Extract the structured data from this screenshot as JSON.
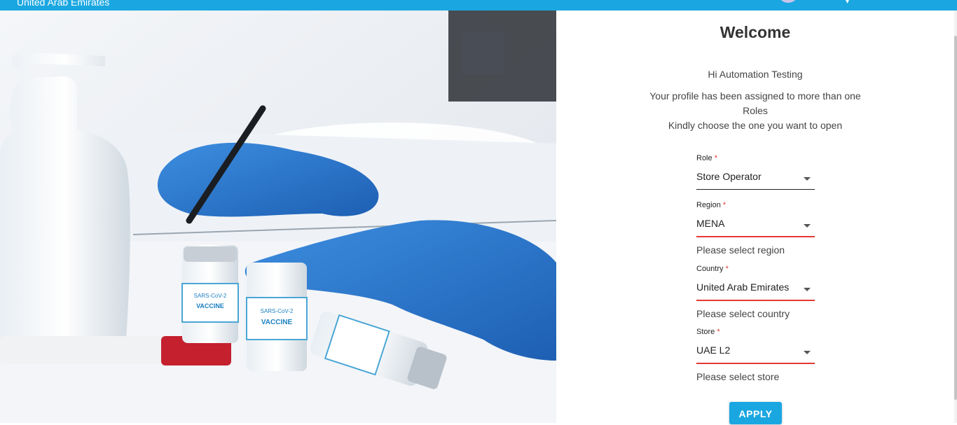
{
  "topbar": {
    "location": "United Arab Emirates"
  },
  "hero": {
    "vial_label_top": "SARS-CoV-2",
    "vial_label_main": "VACCINE"
  },
  "welcome": {
    "title": "Welcome",
    "greeting": "Hi Automation Testing",
    "line1": "Your profile has been assigned to more than one",
    "line2": "Roles",
    "line3": "Kindly choose the one you want to open"
  },
  "form": {
    "role": {
      "label": "Role",
      "required_mark": "*",
      "value": "Store Operator",
      "error": ""
    },
    "region": {
      "label": "Region",
      "required_mark": "*",
      "value": "MENA",
      "error": "Please select region"
    },
    "country": {
      "label": "Country",
      "required_mark": "*",
      "value": "United Arab Emirates",
      "error": "Please select country"
    },
    "store": {
      "label": "Store",
      "required_mark": "*",
      "value": "UAE L2",
      "error": "Please select store"
    },
    "apply_label": "APPLY"
  },
  "colors": {
    "primary": "#1aa7e1",
    "error": "#e53935"
  }
}
